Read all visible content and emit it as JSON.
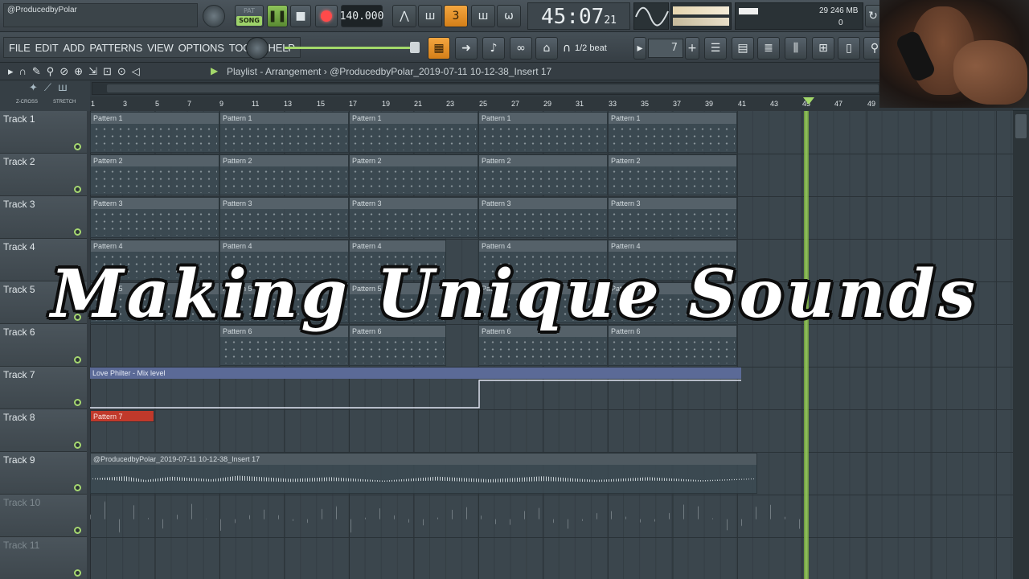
{
  "hint": "@ProducedbyPolar",
  "transport": {
    "pat_label": "PAT",
    "song_label": "SONG",
    "tempo": "140.000",
    "time": "45:07",
    "time_sub": "21",
    "cpu": "29",
    "memory": "246 MB",
    "voices": "0"
  },
  "menus": [
    "FILE",
    "EDIT",
    "ADD",
    "PATTERNS",
    "VIEW",
    "OPTIONS",
    "TOOLS",
    "HELP"
  ],
  "toolbar": {
    "snap": "1/2 beat",
    "step": "7"
  },
  "playlist": {
    "title": "Playlist - Arrangement",
    "separator": "›",
    "breadcrumb": "@ProducedbyPolar_2019-07-11 10-12-38_Insert 17",
    "crossfade_label": "Z-CROSS",
    "stretch_label": "STRETCH"
  },
  "ruler": [
    "1",
    "3",
    "5",
    "7",
    "9",
    "11",
    "13",
    "15",
    "17",
    "19",
    "21",
    "23",
    "25",
    "27",
    "29",
    "31",
    "33",
    "35",
    "37",
    "39",
    "41",
    "43",
    "45",
    "47",
    "49"
  ],
  "tracks": [
    {
      "name": "Track 1"
    },
    {
      "name": "Track 2"
    },
    {
      "name": "Track 3"
    },
    {
      "name": "Track 4"
    },
    {
      "name": "Track 5"
    },
    {
      "name": "Track 6"
    },
    {
      "name": "Track 7"
    },
    {
      "name": "Track 8"
    },
    {
      "name": "Track 9"
    },
    {
      "name": "Track 10"
    },
    {
      "name": "Track 11"
    }
  ],
  "clips": {
    "pattern1": "Pattern 1",
    "pattern2": "Pattern 2",
    "pattern3": "Pattern 3",
    "pattern4": "Pattern 4",
    "pattern5": "Pattern 5",
    "pattern6": "Pattern 6",
    "pattern7": "Pattern 7",
    "automation": "Love Philter - Mix level",
    "audio": "@ProducedbyPolar_2019-07-11 10-12-38_Insert 17"
  },
  "overlay_title": "Making Unique Sounds",
  "colors": {
    "accent_green": "#a3d96a",
    "record_red": "#ff4a4a",
    "snap_orange": "#f3a640",
    "automation_blue": "#5b6a97",
    "pattern7_red": "#c0392b"
  }
}
